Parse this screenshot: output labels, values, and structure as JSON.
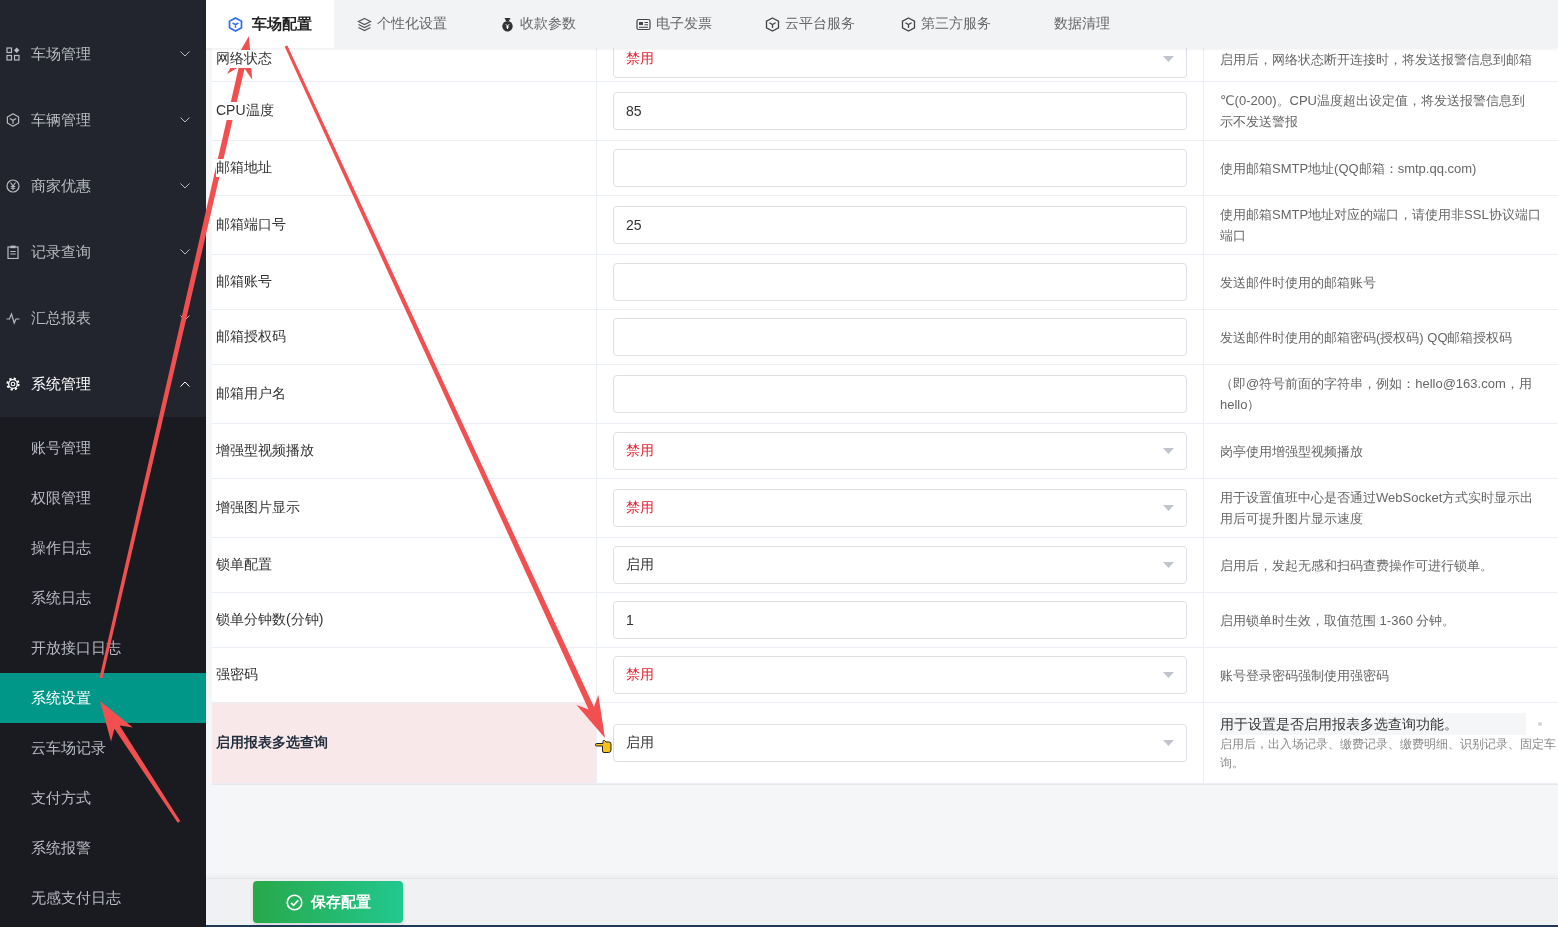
{
  "sidebar": {
    "menus": [
      {
        "label": "车场管理",
        "expanded": false
      },
      {
        "label": "车辆管理",
        "expanded": false
      },
      {
        "label": "商家优惠",
        "expanded": false
      },
      {
        "label": "记录查询",
        "expanded": false
      },
      {
        "label": "汇总报表",
        "expanded": false
      },
      {
        "label": "系统管理",
        "expanded": true,
        "children": [
          {
            "label": "账号管理",
            "selected": false
          },
          {
            "label": "权限管理",
            "selected": false
          },
          {
            "label": "操作日志",
            "selected": false
          },
          {
            "label": "系统日志",
            "selected": false
          },
          {
            "label": "开放接口日志",
            "selected": false
          },
          {
            "label": "系统设置",
            "selected": true
          },
          {
            "label": "云车场记录",
            "selected": false
          },
          {
            "label": "支付方式",
            "selected": false
          },
          {
            "label": "系统报警",
            "selected": false
          },
          {
            "label": "无感支付日志",
            "selected": false
          }
        ]
      }
    ]
  },
  "tabs": [
    {
      "label": "车场配置",
      "selected": true
    },
    {
      "label": "个性化设置",
      "selected": false
    },
    {
      "label": "收款参数",
      "selected": false
    },
    {
      "label": "电子发票",
      "selected": false
    },
    {
      "label": "云平台服务",
      "selected": false
    },
    {
      "label": "第三方服务",
      "selected": false
    },
    {
      "label": "数据清理",
      "selected": false
    }
  ],
  "settings": [
    {
      "label": "网络状态",
      "kind": "select",
      "value": "禁用",
      "alert": true,
      "highlighted": false,
      "description": [
        "启用后，网络状态断开连接时，将发送报警信息到邮箱"
      ]
    },
    {
      "label": "CPU温度",
      "kind": "input",
      "value": "85",
      "highlighted": false,
      "description": [
        "℃(0-200)。CPU温度超出设定值，将发送报警信息到",
        "示不发送警报"
      ]
    },
    {
      "label": "邮箱地址",
      "kind": "input",
      "highlighted": false,
      "description": [
        "使用邮箱SMTP地址(QQ邮箱：smtp.qq.com)"
      ]
    },
    {
      "label": "邮箱端口号",
      "kind": "input",
      "value": "25",
      "highlighted": false,
      "description": [
        "使用邮箱SMTP地址对应的端口，请使用非SSL协议端口",
        "端口"
      ]
    },
    {
      "label": "邮箱账号",
      "kind": "input",
      "highlighted": false,
      "description": [
        "发送邮件时使用的邮箱账号"
      ]
    },
    {
      "label": "邮箱授权码",
      "kind": "input",
      "highlighted": false,
      "description": [
        "发送邮件时使用的邮箱密码(授权码) QQ邮箱授权码"
      ]
    },
    {
      "label": "邮箱用户名",
      "kind": "input",
      "highlighted": false,
      "description": [
        "（即@符号前面的字符串，例如：hello@163.com，用",
        "hello）"
      ]
    },
    {
      "label": "增强型视频播放",
      "kind": "select",
      "value": "禁用",
      "alert": true,
      "highlighted": false,
      "description": [
        "岗亭使用增强型视频播放"
      ]
    },
    {
      "label": "增强图片显示",
      "kind": "select",
      "value": "禁用",
      "alert": true,
      "highlighted": false,
      "description": [
        "用于设置值班中心是否通过WebSocket方式实时显示出",
        "用后可提升图片显示速度"
      ]
    },
    {
      "label": "锁单配置",
      "kind": "select",
      "value": "启用",
      "alert": false,
      "highlighted": false,
      "description": [
        "启用后，发起无感和扫码查费操作可进行锁单。"
      ]
    },
    {
      "label": "锁单分钟数(分钟)",
      "kind": "input",
      "value": "1",
      "highlighted": false,
      "description": [
        "启用锁单时生效，取值范围 1-360 分钟。"
      ]
    },
    {
      "label": "强密码",
      "kind": "select",
      "value": "禁用",
      "alert": true,
      "highlighted": false,
      "description": [
        "账号登录密码强制使用强密码"
      ]
    },
    {
      "label": "启用报表多选查询",
      "kind": "select",
      "value": "启用",
      "alert": false,
      "highlighted": true,
      "description": [
        "用于设置是否启用报表多选查询功能。"
      ],
      "note": [
        "启用后，出入场记录、缴费记录、缴费明细、识别记录、固定车",
        "询。"
      ]
    }
  ],
  "save_button": {
    "label": "保存配置"
  }
}
